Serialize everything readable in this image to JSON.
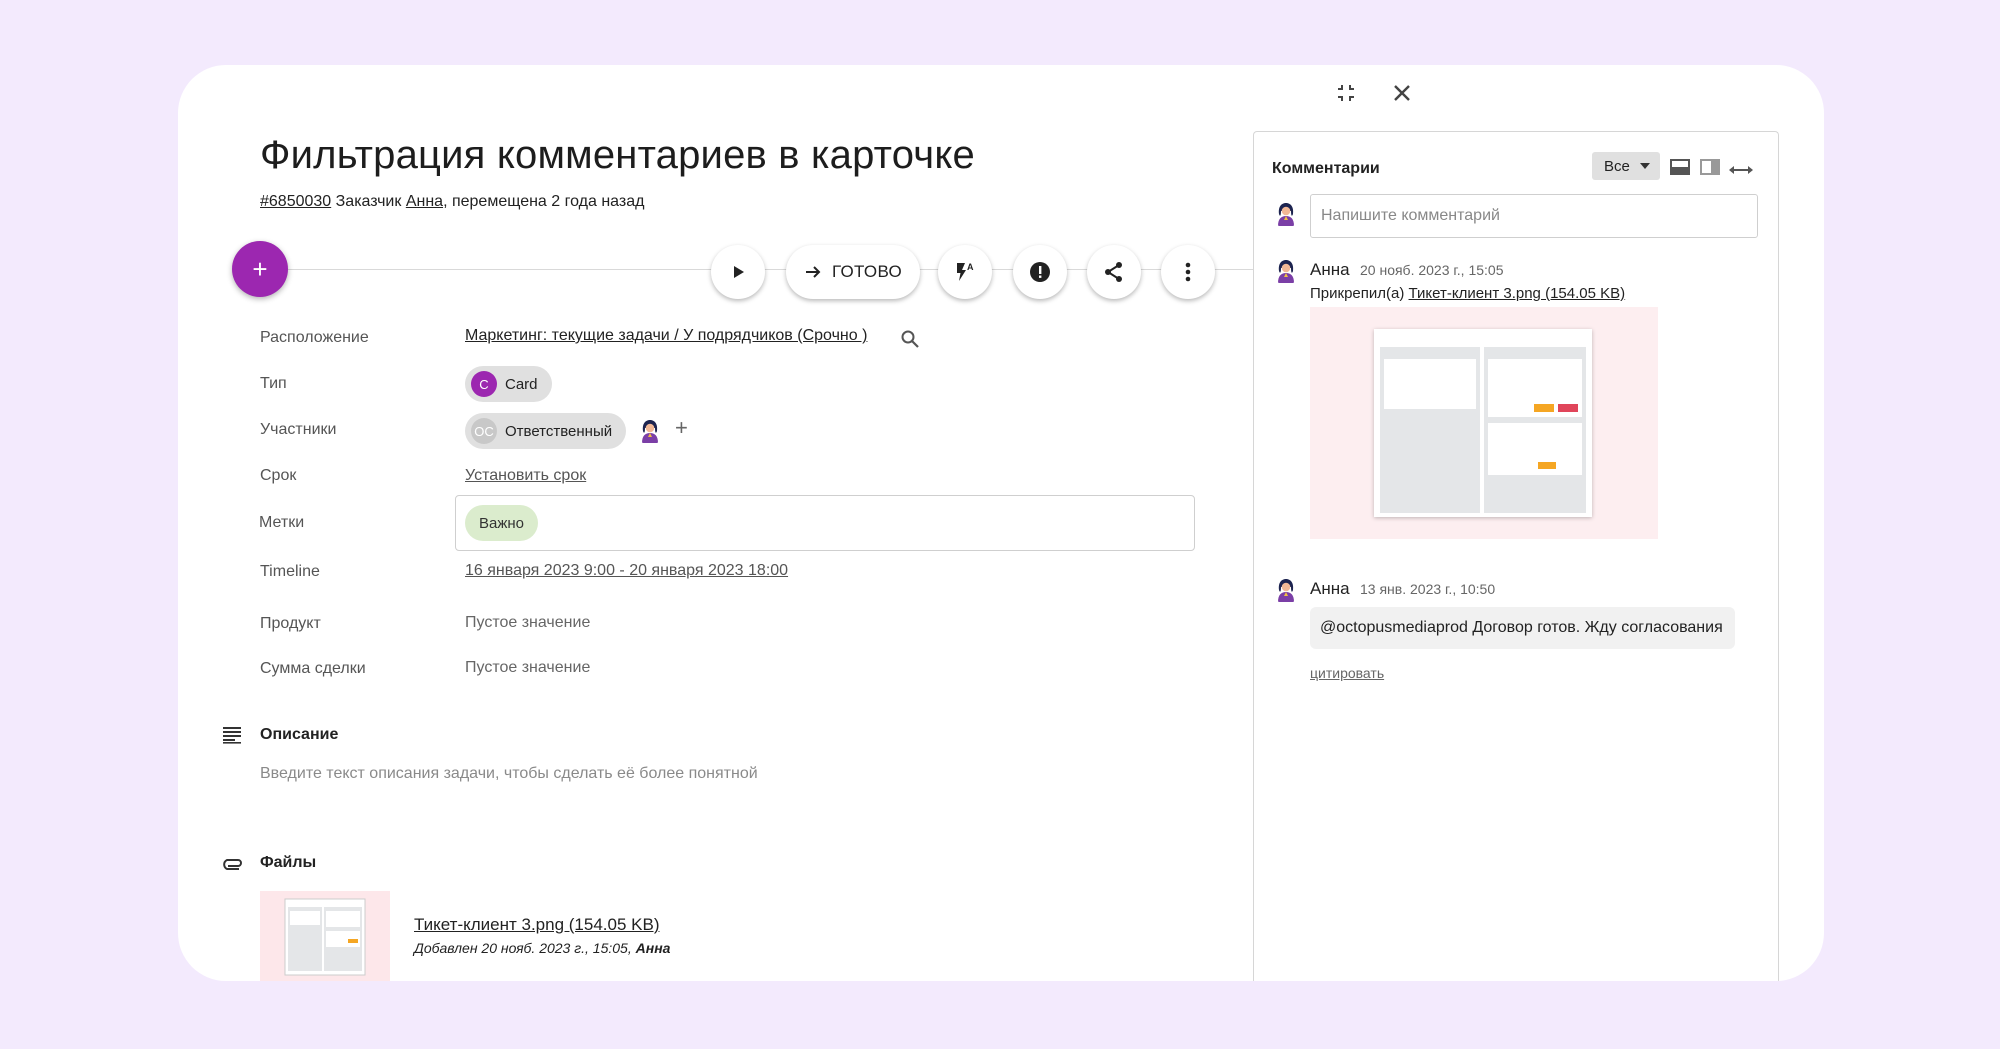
{
  "task": {
    "title": "Фильтрация комментариев в карточке",
    "id": "#6850030",
    "customer_label": "Заказчик",
    "customer_name": "Анна",
    "moved_text": ", перемещена 2 года назад"
  },
  "toolbar": {
    "add_label": "+",
    "done_label": "ГОТОВО"
  },
  "fields": {
    "location_label": "Расположение",
    "location_value": "Маркетинг: текущие задачи / У подрядчиков (Срочно )",
    "type_label": "Тип",
    "type_initial": "C",
    "type_value": "Card",
    "participants_label": "Участники",
    "participant_initials": "ОС",
    "participant_role": "Ответственный",
    "add_participant": "+",
    "deadline_label": "Срок",
    "deadline_value": "Установить срок",
    "tags_label": "Метки",
    "tag_value": "Важно",
    "timeline_label": "Timeline",
    "timeline_value": "16 января 2023 9:00 - 20 января 2023 18:00",
    "product_label": "Продукт",
    "product_value": "Пустое значение",
    "deal_label": "Сумма сделки",
    "deal_value": "Пустое значение"
  },
  "description": {
    "title": "Описание",
    "placeholder": "Введите текст описания задачи, чтобы сделать её более понятной"
  },
  "files": {
    "title": "Файлы",
    "name": "Тикет-клиент 3.png (154.05 KB)",
    "added_prefix": "Добавлен 20 нояб. 2023 г., 15:05,",
    "added_author": "Анна"
  },
  "comments": {
    "title": "Комментарии",
    "filter_value": "Все",
    "input_placeholder": "Напишите комментарий",
    "items": [
      {
        "author": "Анна",
        "date": "20 нояб. 2023 г., 15:05",
        "attach_prefix": "Прикрепил(а)",
        "attach_name": "Тикет-клиент 3.png (154.05 KB)"
      },
      {
        "author": "Анна",
        "date": "13 янв. 2023 г., 10:50",
        "text": "@octopusmediaprod Договор готов. Жду согласования",
        "quote_label": "цитировать"
      }
    ]
  },
  "colors": {
    "background": "#f3eafd",
    "accent": "#9c27b0",
    "tag": "#dbeccd"
  }
}
